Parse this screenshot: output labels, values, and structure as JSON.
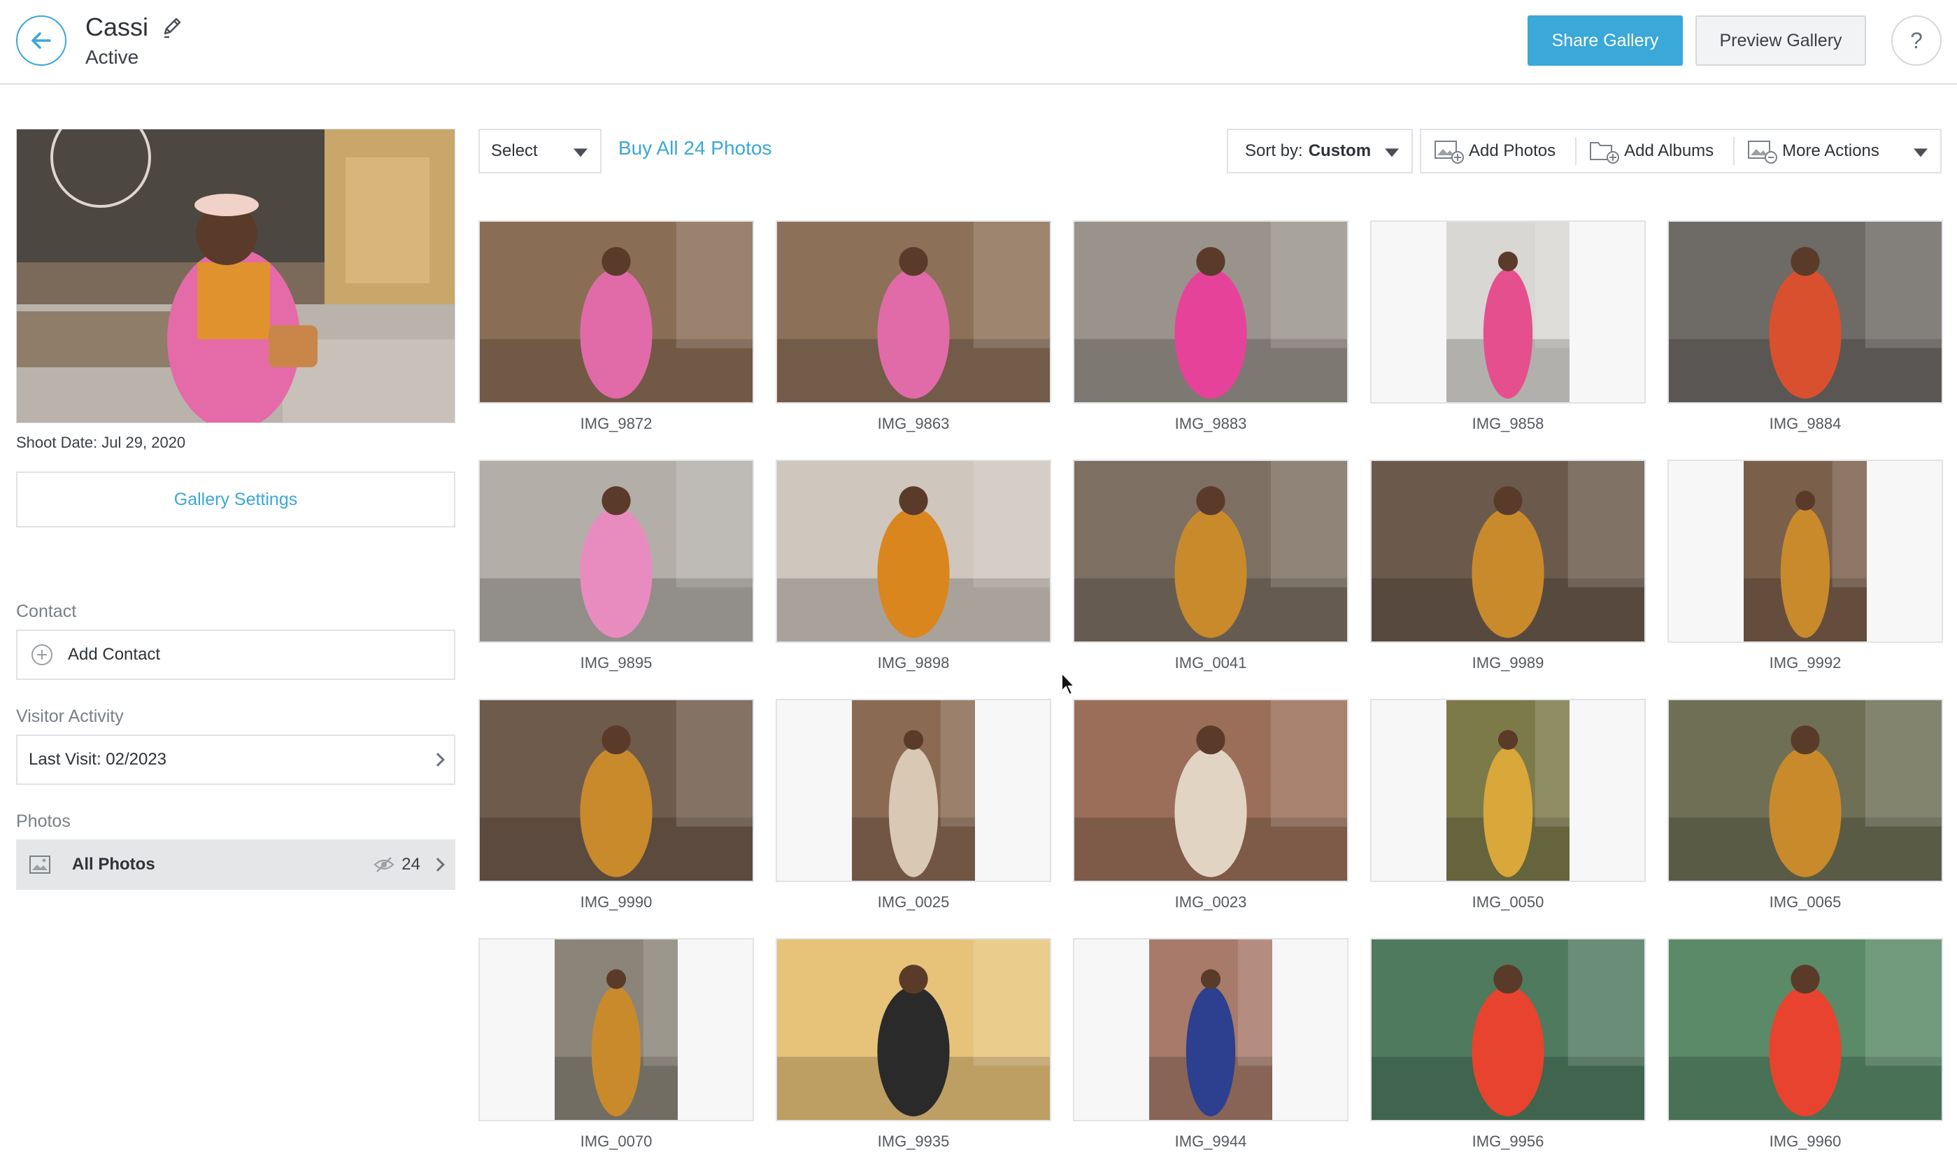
{
  "header": {
    "gallery_name": "Cassi",
    "status": "Active",
    "share_label": "Share Gallery",
    "preview_label": "Preview Gallery",
    "help_label": "?"
  },
  "sidebar": {
    "shoot_date": "Shoot Date: Jul 29, 2020",
    "settings_label": "Gallery Settings",
    "contact_heading": "Contact",
    "add_contact_label": "Add Contact",
    "visitor_heading": "Visitor Activity",
    "last_visit_label": "Last Visit: 02/2023",
    "photos_heading": "Photos",
    "all_photos_label": "All Photos",
    "all_photos_count": "24"
  },
  "toolbar": {
    "select_label": "Select",
    "buy_label": "Buy All 24 Photos",
    "sort_prefix": "Sort by:",
    "sort_value": "Custom",
    "add_photos_label": "Add Photos",
    "add_albums_label": "Add Albums",
    "more_actions_label": "More Actions"
  },
  "photos": [
    {
      "name": "IMG_9872",
      "orientation": "landscape",
      "bg": "#8a6d55",
      "accent": "#e06ba8"
    },
    {
      "name": "IMG_9863",
      "orientation": "landscape",
      "bg": "#8c7058",
      "accent": "#e06ba8"
    },
    {
      "name": "IMG_9883",
      "orientation": "landscape",
      "bg": "#9a938c",
      "accent": "#e7429a"
    },
    {
      "name": "IMG_9858",
      "orientation": "portrait",
      "bg": "#d9d7d4",
      "accent": "#e64f8e"
    },
    {
      "name": "IMG_9884",
      "orientation": "landscape",
      "bg": "#6e6a66",
      "accent": "#d9502e"
    },
    {
      "name": "IMG_9895",
      "orientation": "landscape",
      "bg": "#b3aea8",
      "accent": "#e88cc0"
    },
    {
      "name": "IMG_9898",
      "orientation": "landscape",
      "bg": "#cfc6bd",
      "accent": "#d9861e"
    },
    {
      "name": "IMG_0041",
      "orientation": "landscape",
      "bg": "#7d6f62",
      "accent": "#c98a2c"
    },
    {
      "name": "IMG_9989",
      "orientation": "landscape",
      "bg": "#6b5a4c",
      "accent": "#c98a2c"
    },
    {
      "name": "IMG_9992",
      "orientation": "portrait",
      "bg": "#7a5f4a",
      "accent": "#c98a2c"
    },
    {
      "name": "IMG_9990",
      "orientation": "landscape",
      "bg": "#6f5b4b",
      "accent": "#c98a2c"
    },
    {
      "name": "IMG_0025",
      "orientation": "portrait",
      "bg": "#8a6a52",
      "accent": "#d8c8b4"
    },
    {
      "name": "IMG_0023",
      "orientation": "landscape",
      "bg": "#9a6e58",
      "accent": "#e2d4c2"
    },
    {
      "name": "IMG_0050",
      "orientation": "portrait",
      "bg": "#7d7a4a",
      "accent": "#d9a73a"
    },
    {
      "name": "IMG_0065",
      "orientation": "landscape",
      "bg": "#6e6f55",
      "accent": "#c98a2c"
    },
    {
      "name": "IMG_0070",
      "orientation": "portrait",
      "bg": "#8a8578",
      "accent": "#c98a2c"
    },
    {
      "name": "IMG_9935",
      "orientation": "landscape",
      "bg": "#e7c37a",
      "accent": "#2a2a2a"
    },
    {
      "name": "IMG_9944",
      "orientation": "portrait",
      "bg": "#a77a6a",
      "accent": "#2d3f8f"
    },
    {
      "name": "IMG_9956",
      "orientation": "landscape",
      "bg": "#4f7a5e",
      "accent": "#e8432e"
    },
    {
      "name": "IMG_9960",
      "orientation": "landscape",
      "bg": "#5a8a68",
      "accent": "#e8432e"
    }
  ],
  "colors": {
    "accent": "#3aa8d8",
    "border": "#dfe2e6"
  }
}
